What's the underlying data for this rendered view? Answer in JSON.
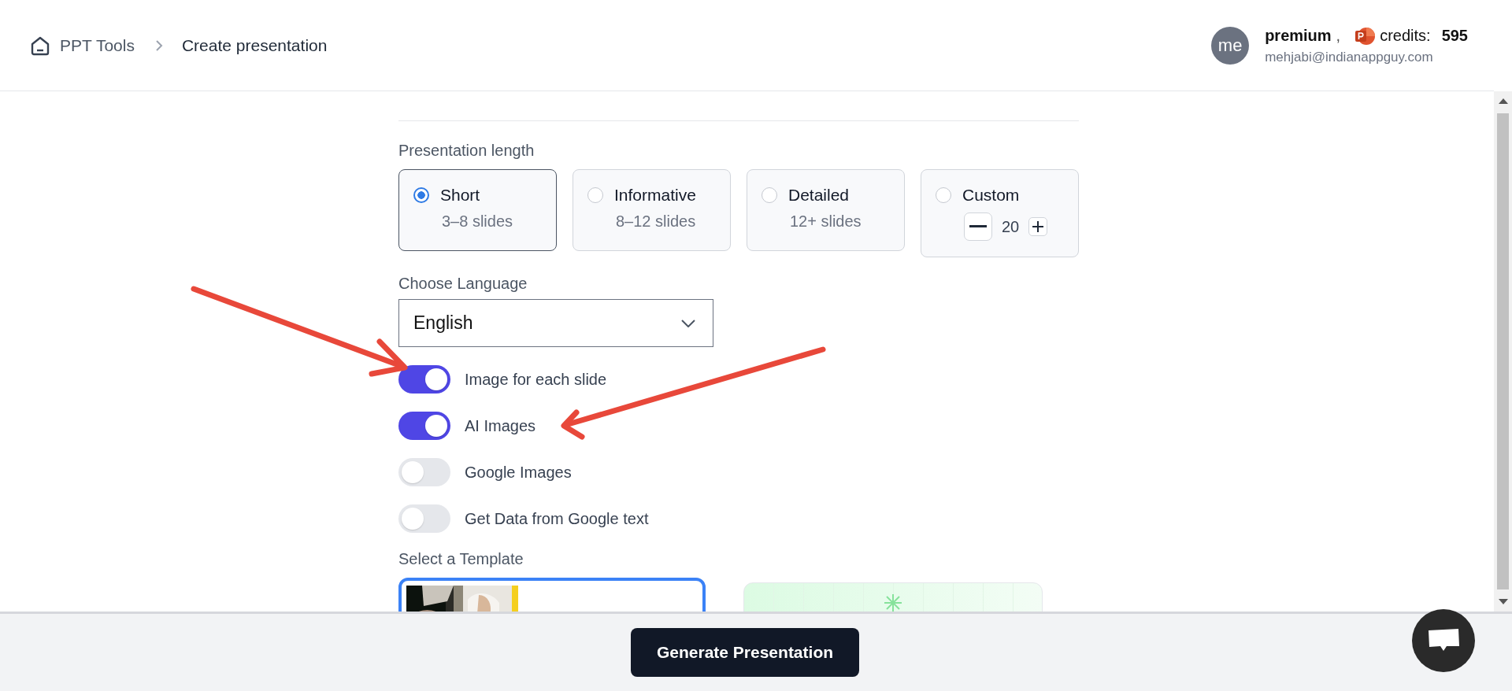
{
  "breadcrumb": [
    {
      "label": "PPT Tools",
      "kind": "home"
    },
    {
      "label": "Create presentation",
      "kind": "current"
    }
  ],
  "user": {
    "avatar": "me",
    "plan": "premium",
    "comma": ",",
    "credits_label": "credits:",
    "credits": "595",
    "email": "mehjabi@indianappguy.com"
  },
  "length": {
    "label": "Presentation length",
    "options": [
      {
        "title": "Short",
        "subtitle": "3–8 slides",
        "selected": true,
        "kind": "preset"
      },
      {
        "title": "Informative",
        "subtitle": "8–12 slides",
        "selected": false,
        "kind": "preset"
      },
      {
        "title": "Detailed",
        "subtitle": "12+ slides",
        "selected": false,
        "kind": "preset"
      },
      {
        "title": "Custom",
        "count": "20",
        "selected": false,
        "kind": "custom"
      }
    ]
  },
  "language": {
    "label": "Choose Language",
    "value": "English"
  },
  "toggles": [
    {
      "label": "Image for each slide",
      "on": true
    },
    {
      "label": "AI Images",
      "on": true
    },
    {
      "label": "Google Images",
      "on": false
    },
    {
      "label": "Get Data from Google text",
      "on": false
    }
  ],
  "templates": {
    "label": "Select a Template",
    "items": [
      {
        "kind": "picture",
        "selected": true
      },
      {
        "kind": "pattern",
        "selected": false
      }
    ]
  },
  "generate_button": "Generate Presentation"
}
